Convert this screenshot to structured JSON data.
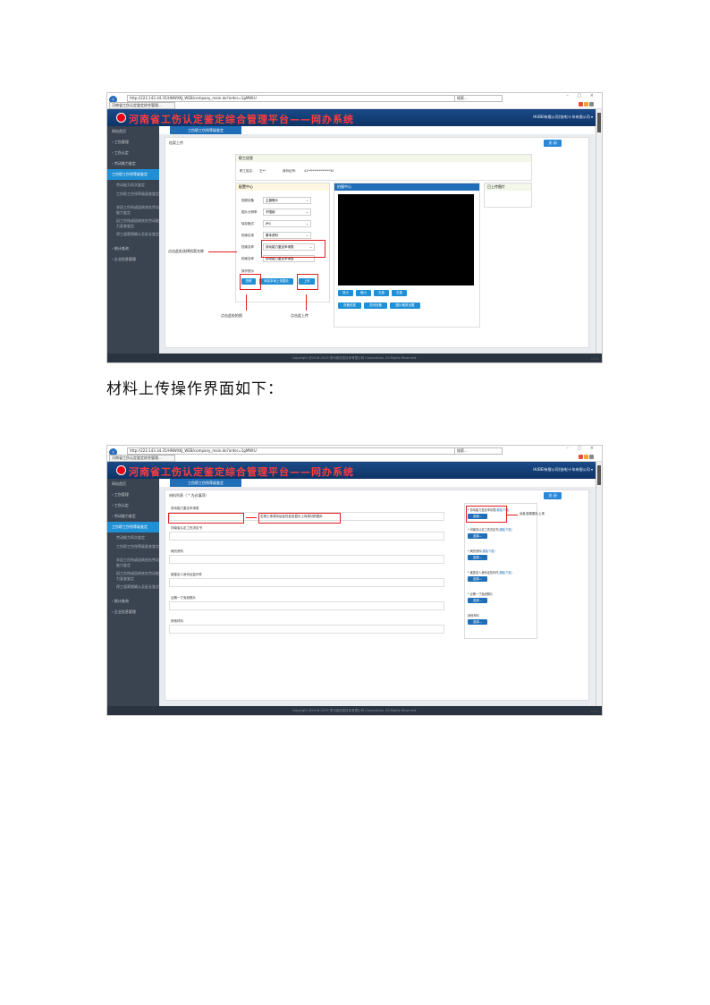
{
  "browser": {
    "address": "http://222.143.34.35/HNWXKJ_WEB/company_main.do?order=1gMWtU",
    "search": "搜索...",
    "tab_title": "河南省工伤认定鉴定综合管理...",
    "window_controls": "– ▢ ×",
    "zoom": "100%"
  },
  "app": {
    "title": "河南省工伤认定鉴定综合管理平台——网办系统",
    "company": "HUBEI有限公司(张伟)十年有限公司 ▾",
    "active_tab": "工伤职工伤残等级鉴定",
    "footer": "Copyright @2016-2019 郑州某信息技术有限公司 Corporation, All Rights Reserved."
  },
  "sidebar": {
    "items": [
      {
        "label": "网站首页",
        "kind": "top"
      },
      {
        "label": "› 工伤管理",
        "kind": "top"
      },
      {
        "label": "› 工伤认定",
        "kind": "top"
      },
      {
        "label": "› 劳动能力鉴定",
        "kind": "top"
      },
      {
        "label": "工伤职工伤残等级鉴定",
        "kind": "active"
      },
      {
        "label": "劳动能力再次鉴定",
        "kind": "sub"
      },
      {
        "label": "工伤职工伤残等级复查鉴定",
        "kind": "sub2"
      },
      {
        "label": "非因工伤残或因病丧失劳动能力鉴定",
        "kind": "sub2"
      },
      {
        "label": "因工伤残或因病丧失劳动能力复查鉴定",
        "kind": "sub2"
      },
      {
        "label": "停工留薪期确认及延长鉴定",
        "kind": "sub2"
      },
      {
        "label": "› 统计查询",
        "kind": "top"
      },
      {
        "label": "› 企业信息管理",
        "kind": "top"
      }
    ]
  },
  "shot1": {
    "panel_title": "档案上传",
    "back_label": "关 闭",
    "staff_box_title": "职工信息",
    "staff_name_label": "职工姓名：",
    "staff_name": "王**",
    "staff_id_label": "身份证号：",
    "staff_id": "41**************30",
    "config_title": "配置中心",
    "fields": [
      {
        "label": "视频设备",
        "value": "主摄像头"
      },
      {
        "label": "图片分辨率",
        "value": "不限制"
      },
      {
        "label": "保存格式",
        "value": "JPG"
      },
      {
        "label": "档案目录",
        "value": "基本资料"
      },
      {
        "label": "档案名称",
        "value": "劳动能力鉴定申请表"
      }
    ],
    "file_name_label": "档案名称",
    "file_name_value": "劳动能力鉴定申请表",
    "ops_label": "操作提示",
    "btn_capture": "拍照",
    "btn_local": "添加本地上传图片",
    "btn_upload": "上传",
    "preview_title": "拍摄中心",
    "uploaded_title": "已上传图片",
    "ctrl_buttons_1": [
      "放大",
      "缩小",
      "左旋",
      "右旋"
    ],
    "ctrl_buttons_2": [
      "设备校准",
      "关闭设备",
      "图片裁剪设置"
    ],
    "annotation_select": "点击此处选择档案名称",
    "annotation_capture": "点击此处拍照",
    "annotation_upload": "点击此上传"
  },
  "caption": "材料上传操作界面如下：",
  "shot2": {
    "panel_title": "材料列表（ * 为必填项）",
    "back_label": "关 闭",
    "materials": [
      "劳动能力鉴定申请表",
      "河南省认定工伤决定书",
      "病历资料",
      "被鉴定人身份证复印件",
      "近期一寸免冠照片",
      "其他材料"
    ],
    "uploads": [
      {
        "label": "* 劳动能力鉴定申请表",
        "link": "(模板下载)"
      },
      {
        "label": "* 河南省认定工伤决定书",
        "link": "(模板下载)"
      },
      {
        "label": "* 病历资料",
        "link": "(模板下载)"
      },
      {
        "label": "* 被鉴定人身份证复印件",
        "link": "(模板下载)"
      },
      {
        "label": "* 近期一寸免冠照片",
        "link": ""
      },
      {
        "label": "其他材料",
        "link": ""
      }
    ],
    "choose_label": "选择...",
    "annotation_left": "右侧上传成功后会在此处显示上传成功的图片",
    "annotation_right": "此处选择图片上传"
  },
  "colors": {
    "banner": "#1a4a88",
    "title_red": "#ff3c3c",
    "accent": "#1f8fd6",
    "annotation": "#e02020"
  }
}
